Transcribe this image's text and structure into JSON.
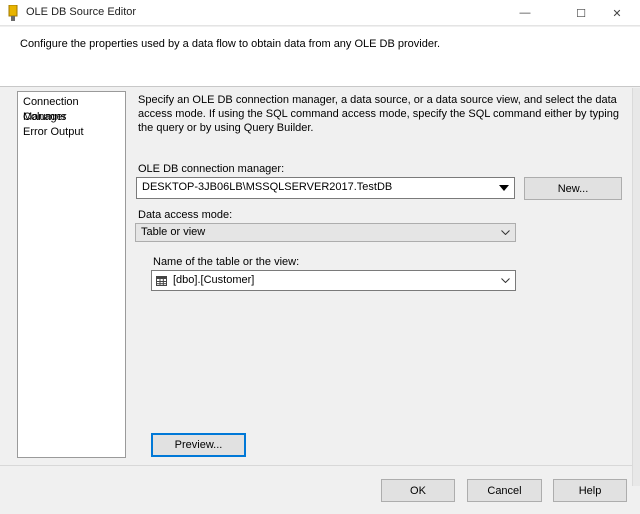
{
  "window": {
    "title": "OLE DB Source Editor",
    "minimize_glyph": "—",
    "maximize_glyph": "☐",
    "close_glyph": "✕"
  },
  "header": {
    "description": "Configure the properties used by a data flow to obtain data from any OLE DB provider."
  },
  "nav": {
    "items": [
      {
        "label": "Connection Manager"
      },
      {
        "label": "Columns"
      },
      {
        "label": "Error Output"
      }
    ]
  },
  "main": {
    "description": "Specify an OLE DB connection manager, a data source, or a data source view, and select the data access mode. If using the SQL command access mode, specify the SQL command either by typing the query or by using Query Builder.",
    "connection_manager_label": "OLE DB connection manager:",
    "connection_manager_value": "DESKTOP-3JB06LB\\MSSQLSERVER2017.TestDB",
    "new_button": "New...",
    "data_access_mode_label": "Data access mode:",
    "data_access_mode_value": "Table or view",
    "table_name_label": "Name of the table or the view:",
    "table_name_value": "[dbo].[Customer]",
    "preview_button": "Preview..."
  },
  "footer": {
    "ok": "OK",
    "cancel": "Cancel",
    "help": "Help"
  },
  "colors": {
    "accent": "#0078d7",
    "title_icon": "#e8b400"
  }
}
